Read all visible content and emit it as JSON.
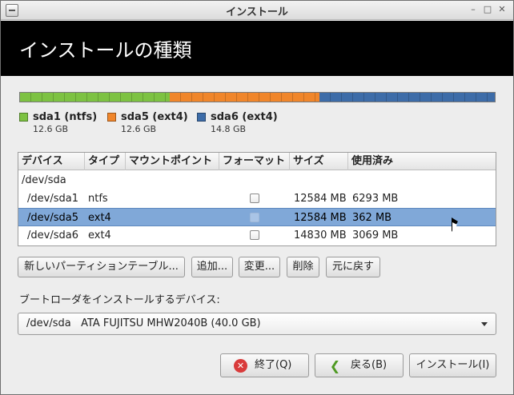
{
  "window": {
    "title": "インストール",
    "minimize_glyph": "–",
    "maximize_glyph": "□",
    "close_glyph": "✕"
  },
  "banner": {
    "heading": "インストールの種類"
  },
  "partition_bar": {
    "segments": [
      {
        "name": "sda1 (ntfs)",
        "size": "12.6 GB",
        "color": "#7dc242",
        "fraction": 0.315
      },
      {
        "name": "sda5 (ext4)",
        "size": "12.6 GB",
        "color": "#f0862b",
        "fraction": 0.315
      },
      {
        "name": "sda6 (ext4)",
        "size": "14.8 GB",
        "color": "#3d6ca8",
        "fraction": 0.37
      }
    ]
  },
  "table": {
    "columns": [
      "デバイス",
      "タイプ",
      "マウントポイント",
      "フォーマット",
      "サイズ",
      "使用済み"
    ],
    "rows": [
      {
        "device": "/dev/sda",
        "type": "",
        "mount": "",
        "format": false,
        "size": "",
        "used": "",
        "is_disk": true,
        "selected": false
      },
      {
        "device": "/dev/sda1",
        "type": "ntfs",
        "mount": "",
        "format": false,
        "size": "12584 MB",
        "used": "6293 MB",
        "is_disk": false,
        "selected": false
      },
      {
        "device": "/dev/sda5",
        "type": "ext4",
        "mount": "",
        "format": false,
        "size": "12584 MB",
        "used": "362 MB",
        "is_disk": false,
        "selected": true
      },
      {
        "device": "/dev/sda6",
        "type": "ext4",
        "mount": "",
        "format": false,
        "size": "14830 MB",
        "used": "3069 MB",
        "is_disk": false,
        "selected": false
      }
    ]
  },
  "actions": {
    "new_table": "新しいパーティションテーブル...",
    "add": "追加...",
    "change": "変更...",
    "delete": "削除",
    "revert": "元に戻す"
  },
  "bootloader": {
    "label": "ブートローダをインストールするデバイス:",
    "selected": "/dev/sda   ATA FUJITSU MHW2040B (40.0 GB)"
  },
  "dialog": {
    "quit": "終了(Q)",
    "back": "戻る(B)",
    "install": "インストール(I)"
  }
}
